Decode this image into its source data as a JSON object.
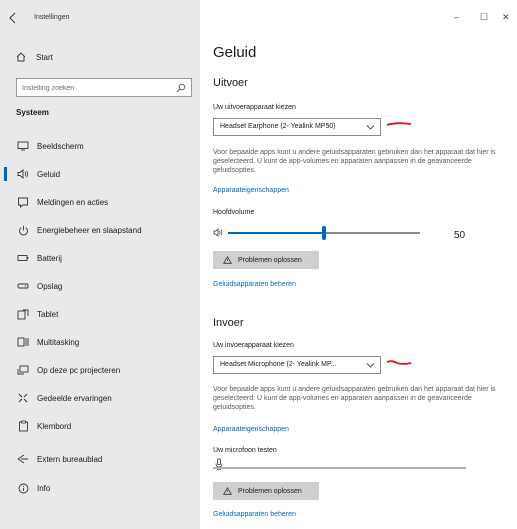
{
  "window": {
    "title": "Instellingen",
    "controls": {
      "minimize": "–",
      "maximize": "☐",
      "close": "✕"
    }
  },
  "sidebar": {
    "start_label": "Start",
    "search_placeholder": "Instelling zoeken",
    "section_label": "Systeem",
    "items": [
      {
        "label": "Beeldscherm",
        "icon": "monitor-icon"
      },
      {
        "label": "Geluid",
        "icon": "speaker-icon",
        "active": true
      },
      {
        "label": "Meldingen en acties",
        "icon": "notification-icon"
      },
      {
        "label": "Energiebeheer en slaapstand",
        "icon": "power-icon"
      },
      {
        "label": "Batterij",
        "icon": "battery-icon"
      },
      {
        "label": "Opslag",
        "icon": "storage-icon"
      },
      {
        "label": "Tablet",
        "icon": "tablet-icon"
      },
      {
        "label": "Multitasking",
        "icon": "multitasking-icon"
      },
      {
        "label": "Op deze pc projecteren",
        "icon": "project-icon"
      },
      {
        "label": "Gedeelde ervaringen",
        "icon": "shared-experiences-icon"
      },
      {
        "label": "Klembord",
        "icon": "clipboard-icon"
      },
      {
        "label": "Extern bureaublad",
        "icon": "remote-desktop-icon"
      },
      {
        "label": "Info",
        "icon": "info-icon"
      }
    ]
  },
  "main": {
    "title": "Geluid",
    "output": {
      "heading": "Uitvoer",
      "device_label": "Uw uitvoerapparaat kiezen",
      "device_value": "Headset Earphone (2- Yealink MP50)",
      "description": "Voor bepaalde apps kunt u andere geluidsapparaten gebruiken dan het apparaat dat hier is geselecteerd. U kunt de app-volumes en apparaten aanpassen in de geavanceerde geluidsopties.",
      "properties_link": "Apparaateigenschappen",
      "volume_label": "Hoofdvolume",
      "volume_value": "50",
      "volume_fraction": 0.5,
      "troubleshoot_label": "Problemen oplossen",
      "manage_link": "Geluidsapparaten beheren"
    },
    "input": {
      "heading": "Invoer",
      "device_label": "Uw invoerapparaat kiezen",
      "device_value": "Headset Microphone (2- Yealink MP...",
      "description": "Voor bepaalde apps kunt u andere geluidsapparaten gebruiken dan het apparaat dat hier is geselecteerd. U kunt de app-volumes en apparaten aanpassen in de geavanceerde geluidsopties.",
      "properties_link": "Apparaateigenschappen",
      "mic_test_label": "Uw microfoon testen",
      "mic_level_fraction": 0,
      "troubleshoot_label": "Problemen oplossen",
      "manage_link": "Geluidsapparaten beheren"
    }
  },
  "colors": {
    "accent": "#0067c0",
    "annotation": "#d11a1a",
    "sidebar_bg": "#e9e9e9"
  }
}
